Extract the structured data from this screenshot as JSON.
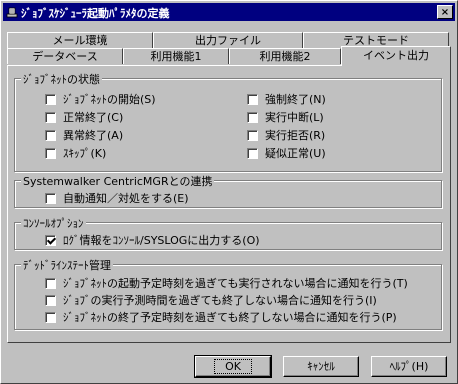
{
  "window": {
    "title": "ｼﾞｮﾌﾞｽｹｼﾞｭｰﾗ起動ﾊﾟﾗﾒﾀの定義",
    "close": "×"
  },
  "tabs_row1": [
    {
      "label": "メール環境"
    },
    {
      "label": "出力ファイル"
    },
    {
      "label": "テストモード"
    }
  ],
  "tabs_row2": [
    {
      "label": "データベース"
    },
    {
      "label": "利用機能1"
    },
    {
      "label": "利用機能2"
    },
    {
      "label": "イベント出力"
    }
  ],
  "groups": {
    "jobnet_status": {
      "title": "ｼﾞｮﾌﾞﾈｯﾄの状態",
      "left": [
        {
          "label": "ｼﾞｮﾌﾞﾈｯﾄの開始(S)",
          "checked": false
        },
        {
          "label": "正常終了(C)",
          "checked": false
        },
        {
          "label": "異常終了(A)",
          "checked": false
        },
        {
          "label": "ｽｷｯﾌﾟ(K)",
          "checked": false
        }
      ],
      "right": [
        {
          "label": "強制終了(N)",
          "checked": false
        },
        {
          "label": "実行中断(L)",
          "checked": false
        },
        {
          "label": "実行拒否(R)",
          "checked": false
        },
        {
          "label": "疑似正常(U)",
          "checked": false
        }
      ]
    },
    "centric": {
      "title": "Systemwalker CentricMGRとの連携",
      "items": [
        {
          "label": "自動通知／対処をする(E)",
          "checked": false
        }
      ]
    },
    "console": {
      "title": "ｺﾝｿｰﾙｵﾌﾟｼｮﾝ",
      "items": [
        {
          "label": "ﾛｸﾞ情報をｺﾝｿｰﾙ/SYSLOGに出力する(O)",
          "checked": true
        }
      ]
    },
    "deadline": {
      "title": "ﾃﾞｯﾄﾞﾗｲﾝｽﾃｰﾄ管理",
      "items": [
        {
          "label": "ｼﾞｮﾌﾞﾈｯﾄの起動予定時刻を過ぎても実行されない場合に通知を行う(T)",
          "checked": false
        },
        {
          "label": "ｼﾞｮﾌﾞの実行予測時間を過ぎても終了しない場合に通知を行う(I)",
          "checked": false
        },
        {
          "label": "ｼﾞｮﾌﾞﾈｯﾄの終了予定時刻を過ぎても終了しない場合に通知を行う(P)",
          "checked": false
        }
      ]
    }
  },
  "buttons": {
    "ok": "OK",
    "cancel": "ｷｬﾝｾﾙ",
    "help": "ﾍﾙﾌﾟ(H)"
  }
}
